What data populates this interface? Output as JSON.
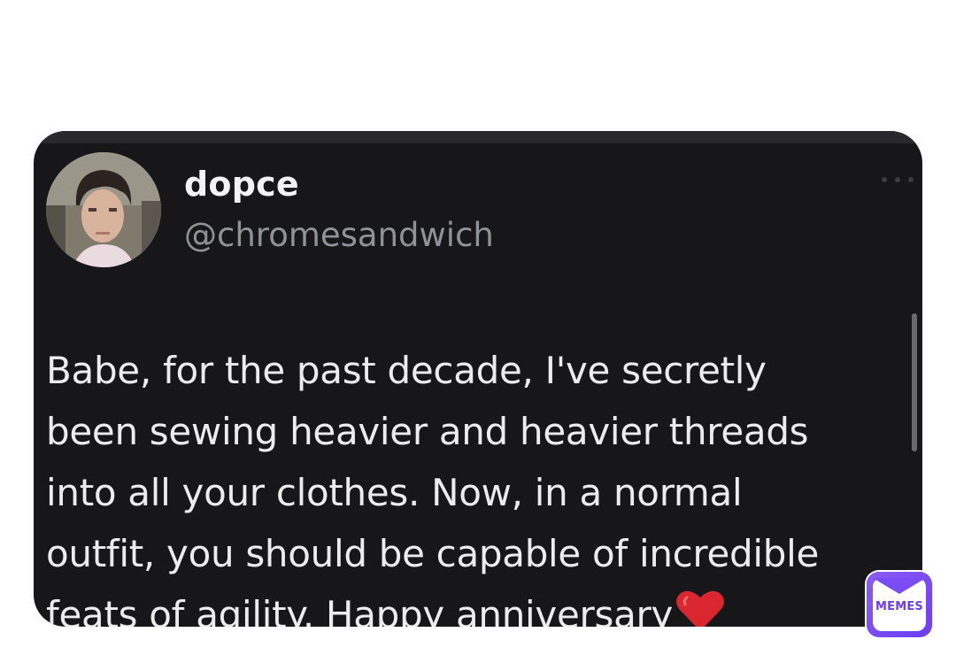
{
  "tweet": {
    "display_name": "dopce",
    "handle": "@chromesandwich",
    "lines": [
      "Babe, for the past decade, I've secretly",
      "been sewing heavier and heavier threads",
      "into all your clothes. Now, in a normal",
      "outfit, you should be capable of incredible",
      "feats of agility. Happy anniversary"
    ],
    "emoji": "heart-icon"
  },
  "watermark": {
    "label": "MEMES"
  },
  "colors": {
    "card_background": "#17171a",
    "text_primary": "#ececec",
    "text_secondary": "#8f9296",
    "heart": "#d9262f",
    "badge": "#7a4cf3"
  }
}
